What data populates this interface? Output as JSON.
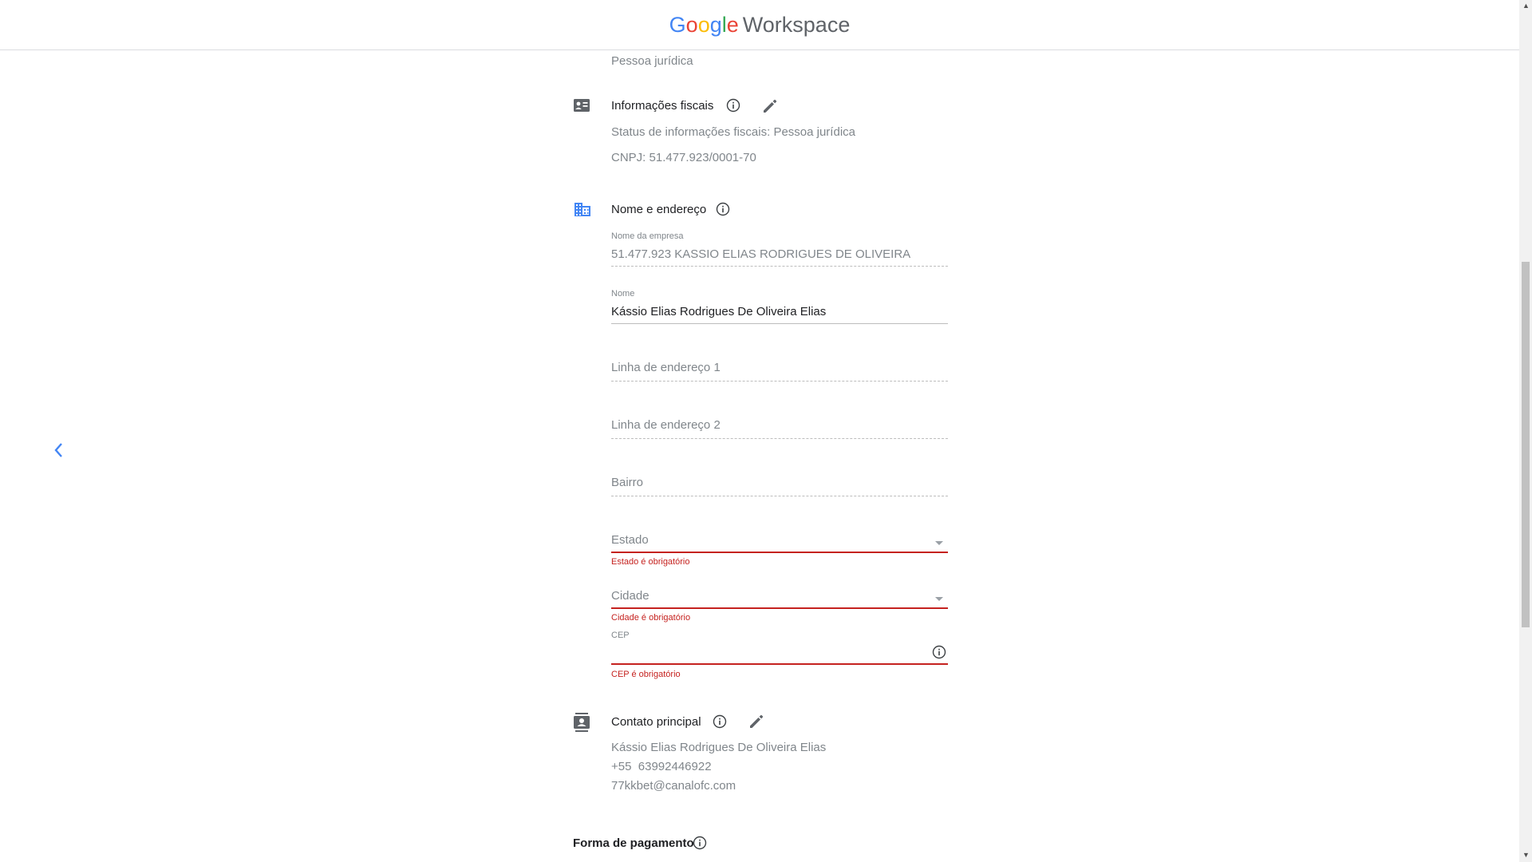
{
  "header": {
    "logo_letters": [
      "G",
      "o",
      "o",
      "g",
      "l",
      "e"
    ],
    "product": "Workspace"
  },
  "account_type": "Pessoa jurídica",
  "tax_info": {
    "title": "Informações fiscais",
    "status_label": "Status de informações fiscais",
    "status_value": "Pessoa jurídica",
    "cnpj_label": "CNPJ",
    "cnpj_value": "51.477.923/0001-70"
  },
  "name_address": {
    "title": "Nome e endereço",
    "company_name_label": "Nome da empresa",
    "company_name_value": "51.477.923 KASSIO ELIAS RODRIGUES DE OLIVEIRA",
    "name_label": "Nome",
    "name_value": "Kássio Elias Rodrigues De Oliveira Elias",
    "address1_placeholder": "Linha de endereço 1",
    "address2_placeholder": "Linha de endereço 2",
    "district_placeholder": "Bairro",
    "state_placeholder": "Estado",
    "state_error": "Estado é obrigatório",
    "city_placeholder": "Cidade",
    "city_error": "Cidade é obrigatório",
    "cep_label": "CEP",
    "cep_error": "CEP é obrigatório"
  },
  "primary_contact": {
    "title": "Contato principal",
    "name": "Kássio Elias Rodrigues De Oliveira Elias",
    "phone": "+55  63992446922",
    "email": "77kkbet@canalofc.com"
  },
  "payment": {
    "title": "Forma de pagamento"
  },
  "colors": {
    "accent_blue": "#4285f4",
    "error_red": "#c5221f"
  },
  "icons": [
    "chevron-left-icon",
    "id-card-icon",
    "info-icon",
    "pencil-icon",
    "building-icon",
    "contact-card-icon",
    "dropdown-caret-icon"
  ]
}
